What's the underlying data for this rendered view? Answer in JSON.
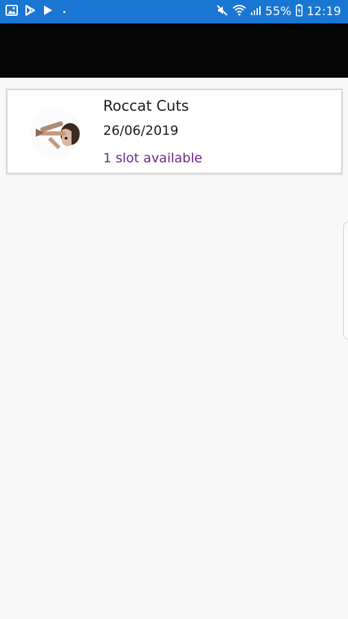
{
  "status_bar": {
    "left_icons": [
      "gallery-notification-icon",
      "play-store-notification-icon",
      "play-store-notification-icon",
      "dot-icon"
    ],
    "battery_percent": "55%",
    "time": "12:19",
    "right_icons": [
      "mute-icon",
      "wifi-icon",
      "signal-icon",
      "battery-icon"
    ],
    "color": "#1976d2"
  },
  "app_bar": {
    "color": "#050505"
  },
  "list": {
    "items": [
      {
        "name": "Roccat Cuts",
        "date": "26/06/2019",
        "availability": "1 slot available",
        "availability_color": "#6a2b8a"
      }
    ]
  }
}
